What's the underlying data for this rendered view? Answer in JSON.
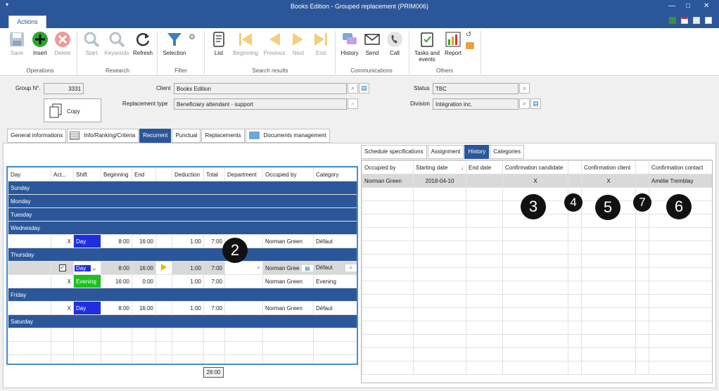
{
  "window": {
    "title": "Books Edition - Grouped replacement (PRIM006)"
  },
  "ribbon": {
    "tab": "Actions",
    "buttons": {
      "save": "Save",
      "insert": "Insert",
      "delete": "Delete",
      "start": "Start",
      "keywords": "Keywords",
      "refresh": "Refresh",
      "selection": "Selection",
      "list": "List",
      "beginning": "Beginning",
      "previous": "Previous",
      "next": "Next",
      "end": "End",
      "history": "History",
      "send": "Send",
      "call": "Call",
      "tasks_line1": "Tasks and",
      "tasks_line2": "events",
      "report": "Report"
    },
    "groups": {
      "operations": "Operations",
      "research": "Research",
      "filter": "Filter",
      "search_results": "Search results",
      "communications": "Communications",
      "others": "Others"
    }
  },
  "form": {
    "group_label": "Group N°.",
    "group_value": "3331",
    "copy": "Copy",
    "client_label": "Client",
    "client_value": "Books Edition",
    "replacement_type_label": "Replacement type",
    "replacement_type_value": "Beneficiary attendant - support",
    "status_label": "Status",
    "status_value": "TBC",
    "division_label": "Division",
    "division_value": "Intégration inc."
  },
  "main_tabs": [
    "General informations",
    "Info/Ranking/Criteria",
    "Recurrent",
    "Punctual",
    "Replacements",
    "Documents management"
  ],
  "recurrent": {
    "headers": [
      "Day",
      "Act...",
      "Shift",
      "Beginning",
      "End",
      "",
      "Deduction",
      "Total",
      "Department",
      "Occupied by",
      "Category"
    ],
    "days": {
      "sunday": "Sunday",
      "monday": "Monday",
      "tuesday": "Tuesday",
      "wednesday": "Wednesday",
      "thursday": "Thursday",
      "friday": "Friday",
      "saturday": "Saturday"
    },
    "rows": [
      {
        "act": "X",
        "shift": "Day",
        "beginning": "8:00",
        "end": "16:00",
        "deduction": "1:00",
        "total": "7:00",
        "occupied": "Norman Green",
        "category": "Défaut"
      },
      {
        "act": "",
        "shift": "Day",
        "beginning": "8:00",
        "end": "16:00",
        "deduction": "1:00",
        "total": "7:00",
        "occupied": "Norman Gree",
        "category": "Défaut"
      },
      {
        "act": "X",
        "shift": "Evening",
        "beginning": "16:00",
        "end": "0:00",
        "deduction": "1:00",
        "total": "7:00",
        "occupied": "Norman Green",
        "category": "Evening"
      },
      {
        "act": "X",
        "shift": "Day",
        "beginning": "8:00",
        "end": "16:00",
        "deduction": "1:00",
        "total": "7:00",
        "occupied": "Norman Green",
        "category": "Défaut"
      }
    ],
    "total_sum": "28:00",
    "shift_colors": {
      "day": "#1f2fe0",
      "evening": "#1fbf1f"
    }
  },
  "right_tabs": [
    "Schedule specifications",
    "Assignment",
    "History",
    "Categories"
  ],
  "history": {
    "headers": [
      "Occupied by",
      "Starting date",
      "End date",
      "Confirmation candidate",
      "",
      "Confirmation client",
      "",
      "Confirmation contact"
    ],
    "row": {
      "occupied": "Norman Green",
      "start": "2018-04-10",
      "end": "",
      "conf_candidate": "X",
      "conf_client": "X",
      "conf_contact": "Amélie Tremblay"
    }
  },
  "callouts": [
    "2",
    "3",
    "4",
    "5",
    "7",
    "6"
  ],
  "colors": {
    "accent": "#2b579a"
  }
}
